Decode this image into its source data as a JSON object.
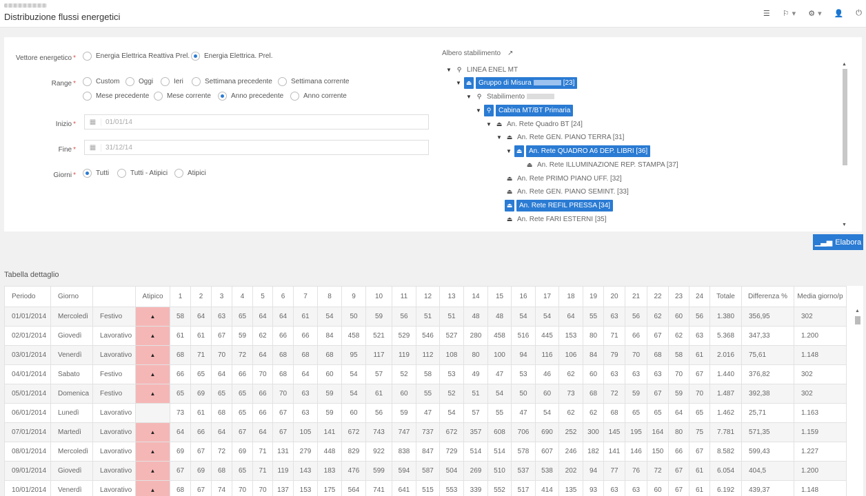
{
  "header": {
    "title": "Distribuzione flussi energetici",
    "icons": [
      "list-icon",
      "flag-icon",
      "gear-icon",
      "user-icon",
      "power-icon"
    ]
  },
  "form": {
    "vettore": {
      "label": "Vettore energetico",
      "options": [
        {
          "label": "Energia Elettrica Reattiva Prel.",
          "checked": false
        },
        {
          "label": "Energia Elettrica. Prel.",
          "checked": true
        }
      ]
    },
    "range": {
      "label": "Range",
      "options": [
        {
          "label": "Custom",
          "checked": false
        },
        {
          "label": "Oggi",
          "checked": false
        },
        {
          "label": "Ieri",
          "checked": false
        },
        {
          "label": "Settimana precedente",
          "checked": false
        },
        {
          "label": "Settimana corrente",
          "checked": false
        },
        {
          "label": "Mese precedente",
          "checked": false
        },
        {
          "label": "Mese corrente",
          "checked": false
        },
        {
          "label": "Anno precedente",
          "checked": true
        },
        {
          "label": "Anno corrente",
          "checked": false
        }
      ]
    },
    "inizio": {
      "label": "Inizio",
      "value": "01/01/14"
    },
    "fine": {
      "label": "Fine",
      "value": "31/12/14"
    },
    "giorni": {
      "label": "Giorni",
      "options": [
        {
          "label": "Tutti",
          "checked": true
        },
        {
          "label": "Tutti - Atipici",
          "checked": false
        },
        {
          "label": "Atipici",
          "checked": false
        }
      ]
    }
  },
  "tree": {
    "title": "Albero stabilimento",
    "nodes": [
      {
        "label": "LINEA ENEL MT",
        "selected": false
      },
      {
        "label_pre": "Gruppo di Misura",
        "label_post": "[23]",
        "selected": true
      },
      {
        "label_pre": "Stabilimento",
        "label_post": "",
        "selected": false
      },
      {
        "label": "Cabina MT/BT Primaria",
        "selected": true
      },
      {
        "label": "An. Rete Quadro BT [24]",
        "selected": false
      },
      {
        "label": "An. Rete GEN. PIANO TERRA [31]",
        "selected": false
      },
      {
        "label": "An. Rete QUADRO A6 DEP. LIBRI [36]",
        "selected": true
      },
      {
        "label": "An. Rete ILLUMINAZIONE REP. STAMPA [37]",
        "selected": false
      },
      {
        "label": "An. Rete PRIMO PIANO UFF. [32]",
        "selected": false
      },
      {
        "label": "An. Rete GEN. PIANO SEMINT. [33]",
        "selected": false
      },
      {
        "label": "An. Rete REFIL PRESSA [34]",
        "selected": true
      },
      {
        "label": "An. Rete FARI ESTERNI [35]",
        "selected": false
      }
    ]
  },
  "elabora_label": "Elabora",
  "table": {
    "title": "Tabella dettaglio",
    "headers": [
      "Periodo",
      "Giorno",
      "",
      "Atipico",
      "1",
      "2",
      "3",
      "4",
      "5",
      "6",
      "7",
      "8",
      "9",
      "10",
      "11",
      "12",
      "13",
      "14",
      "15",
      "16",
      "17",
      "18",
      "19",
      "20",
      "21",
      "22",
      "23",
      "24",
      "Totale",
      "Differenza %",
      "Media giorno/p"
    ],
    "rows": [
      {
        "periodo": "01/01/2014",
        "giorno": "Mercoledì",
        "tipo": "Festivo",
        "atipico": true,
        "h": [
          "58",
          "64",
          "63",
          "65",
          "64",
          "64",
          "61",
          "54",
          "50",
          "59",
          "56",
          "51",
          "51",
          "48",
          "48",
          "54",
          "54",
          "64",
          "55",
          "63",
          "56",
          "62",
          "60",
          "56"
        ],
        "totale": "1.380",
        "diff": "356,95",
        "media": "302"
      },
      {
        "periodo": "02/01/2014",
        "giorno": "Giovedì",
        "tipo": "Lavorativo",
        "atipico": true,
        "h": [
          "61",
          "61",
          "67",
          "59",
          "62",
          "66",
          "66",
          "84",
          "458",
          "521",
          "529",
          "546",
          "527",
          "280",
          "458",
          "516",
          "445",
          "153",
          "80",
          "71",
          "66",
          "67",
          "62",
          "63"
        ],
        "totale": "5.368",
        "diff": "347,33",
        "media": "1.200"
      },
      {
        "periodo": "03/01/2014",
        "giorno": "Venerdì",
        "tipo": "Lavorativo",
        "atipico": true,
        "h": [
          "68",
          "71",
          "70",
          "72",
          "64",
          "68",
          "68",
          "68",
          "95",
          "117",
          "119",
          "112",
          "108",
          "80",
          "100",
          "94",
          "116",
          "106",
          "84",
          "79",
          "70",
          "68",
          "58",
          "61"
        ],
        "totale": "2.016",
        "diff": "75,61",
        "media": "1.148"
      },
      {
        "periodo": "04/01/2014",
        "giorno": "Sabato",
        "tipo": "Festivo",
        "atipico": true,
        "h": [
          "66",
          "65",
          "64",
          "66",
          "70",
          "68",
          "64",
          "60",
          "54",
          "57",
          "52",
          "58",
          "53",
          "49",
          "47",
          "53",
          "46",
          "62",
          "60",
          "63",
          "63",
          "63",
          "70",
          "67"
        ],
        "totale": "1.440",
        "diff": "376,82",
        "media": "302"
      },
      {
        "periodo": "05/01/2014",
        "giorno": "Domenica",
        "tipo": "Festivo",
        "atipico": true,
        "h": [
          "65",
          "69",
          "65",
          "65",
          "66",
          "70",
          "63",
          "59",
          "54",
          "61",
          "60",
          "55",
          "52",
          "51",
          "54",
          "50",
          "60",
          "73",
          "68",
          "72",
          "59",
          "67",
          "59",
          "70"
        ],
        "totale": "1.487",
        "diff": "392,38",
        "media": "302"
      },
      {
        "periodo": "06/01/2014",
        "giorno": "Lunedì",
        "tipo": "Lavorativo",
        "atipico": false,
        "h": [
          "73",
          "61",
          "68",
          "65",
          "66",
          "67",
          "63",
          "59",
          "60",
          "56",
          "59",
          "47",
          "54",
          "57",
          "55",
          "47",
          "54",
          "62",
          "62",
          "68",
          "65",
          "65",
          "64",
          "65"
        ],
        "totale": "1.462",
        "diff": "25,71",
        "media": "1.163"
      },
      {
        "periodo": "07/01/2014",
        "giorno": "Martedì",
        "tipo": "Lavorativo",
        "atipico": true,
        "h": [
          "64",
          "66",
          "64",
          "67",
          "64",
          "67",
          "105",
          "141",
          "672",
          "743",
          "747",
          "737",
          "672",
          "357",
          "608",
          "706",
          "690",
          "252",
          "300",
          "145",
          "195",
          "164",
          "80",
          "75"
        ],
        "totale": "7.781",
        "diff": "571,35",
        "media": "1.159"
      },
      {
        "periodo": "08/01/2014",
        "giorno": "Mercoledì",
        "tipo": "Lavorativo",
        "atipico": true,
        "h": [
          "69",
          "67",
          "72",
          "69",
          "71",
          "131",
          "279",
          "448",
          "829",
          "922",
          "838",
          "847",
          "729",
          "514",
          "514",
          "578",
          "607",
          "246",
          "182",
          "141",
          "146",
          "150",
          "66",
          "67"
        ],
        "totale": "8.582",
        "diff": "599,43",
        "media": "1.227"
      },
      {
        "periodo": "09/01/2014",
        "giorno": "Giovedì",
        "tipo": "Lavorativo",
        "atipico": true,
        "h": [
          "67",
          "69",
          "68",
          "65",
          "71",
          "119",
          "143",
          "183",
          "476",
          "599",
          "594",
          "587",
          "504",
          "269",
          "510",
          "537",
          "538",
          "202",
          "94",
          "77",
          "76",
          "72",
          "67",
          "61"
        ],
        "totale": "6.054",
        "diff": "404,5",
        "media": "1.200"
      },
      {
        "periodo": "10/01/2014",
        "giorno": "Venerdì",
        "tipo": "Lavorativo",
        "atipico": true,
        "h": [
          "68",
          "67",
          "74",
          "70",
          "70",
          "137",
          "153",
          "175",
          "564",
          "741",
          "641",
          "515",
          "553",
          "339",
          "552",
          "517",
          "414",
          "135",
          "93",
          "63",
          "63",
          "60",
          "67",
          "61"
        ],
        "totale": "6.192",
        "diff": "439,37",
        "media": "1.148"
      }
    ]
  }
}
